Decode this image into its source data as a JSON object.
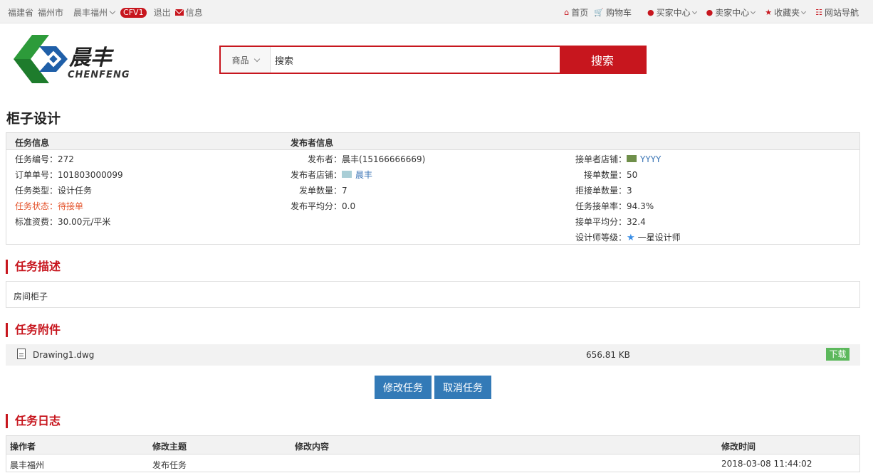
{
  "topbar": {
    "province": "福建省",
    "city": "福州市",
    "user": "晨丰福州",
    "level_badge": "CFV1",
    "logout": "退出",
    "messages": "信息",
    "right_links": [
      {
        "icon": "home-icon",
        "label": "首页"
      },
      {
        "icon": "cart-icon",
        "label": "购物车"
      },
      {
        "icon": "user-icon",
        "label": "买家中心"
      },
      {
        "icon": "user-icon",
        "label": "卖家中心"
      },
      {
        "icon": "star-icon",
        "label": "收藏夹"
      },
      {
        "icon": "grid-icon",
        "label": "网站导航"
      }
    ]
  },
  "brand": {
    "name_cn": "晨丰",
    "name_en": "CHENFENG"
  },
  "search": {
    "category": "商品",
    "query": "搜索",
    "button": "搜索"
  },
  "page_title": "柜子设计",
  "task_info": {
    "header_task": "任务信息",
    "header_publisher": "发布者信息",
    "col1": [
      "任务编号：272",
      "订单单号：101803000099",
      "任务类型：设计任务",
      "任务状态：待接单",
      "标准资费：30.00元/平米"
    ],
    "col2_labels": [
      "发布者：",
      "发布者店铺：",
      "发单数量：",
      "发布平均分："
    ],
    "col2_values": [
      "晨丰(15166666669)",
      "晨丰",
      "7",
      "0.0"
    ],
    "col3_labels": [
      "接单者店铺：",
      "接单数量：",
      "拒接单数量：",
      "任务接单率：",
      "接单平均分：",
      "设计师等级："
    ],
    "col3_values": [
      "YYYY",
      "50",
      "3",
      "94.3%",
      "32.4",
      "一星设计师"
    ]
  },
  "description": {
    "title": "任务描述",
    "text": "房间柜子"
  },
  "attachments": {
    "title": "任务附件",
    "files": [
      {
        "name": "Drawing1.dwg",
        "size": "656.81 KB",
        "action": "下载"
      }
    ]
  },
  "actions": {
    "edit": "修改任务",
    "cancel": "取消任务"
  },
  "log": {
    "title": "任务日志",
    "headers": [
      "操作者",
      "修改主题",
      "修改内容",
      "修改时间"
    ],
    "rows": [
      [
        "晨丰福州",
        "发布任务",
        "",
        "2018-03-08 11:44:02"
      ]
    ]
  },
  "colors": {
    "brand_red": "#c7161e",
    "button_blue": "#337ab7",
    "download_green": "#5cb85c",
    "status_orange": "#e4532b",
    "logo_green": "#2d9b3a",
    "logo_blue": "#1f5fa8"
  }
}
